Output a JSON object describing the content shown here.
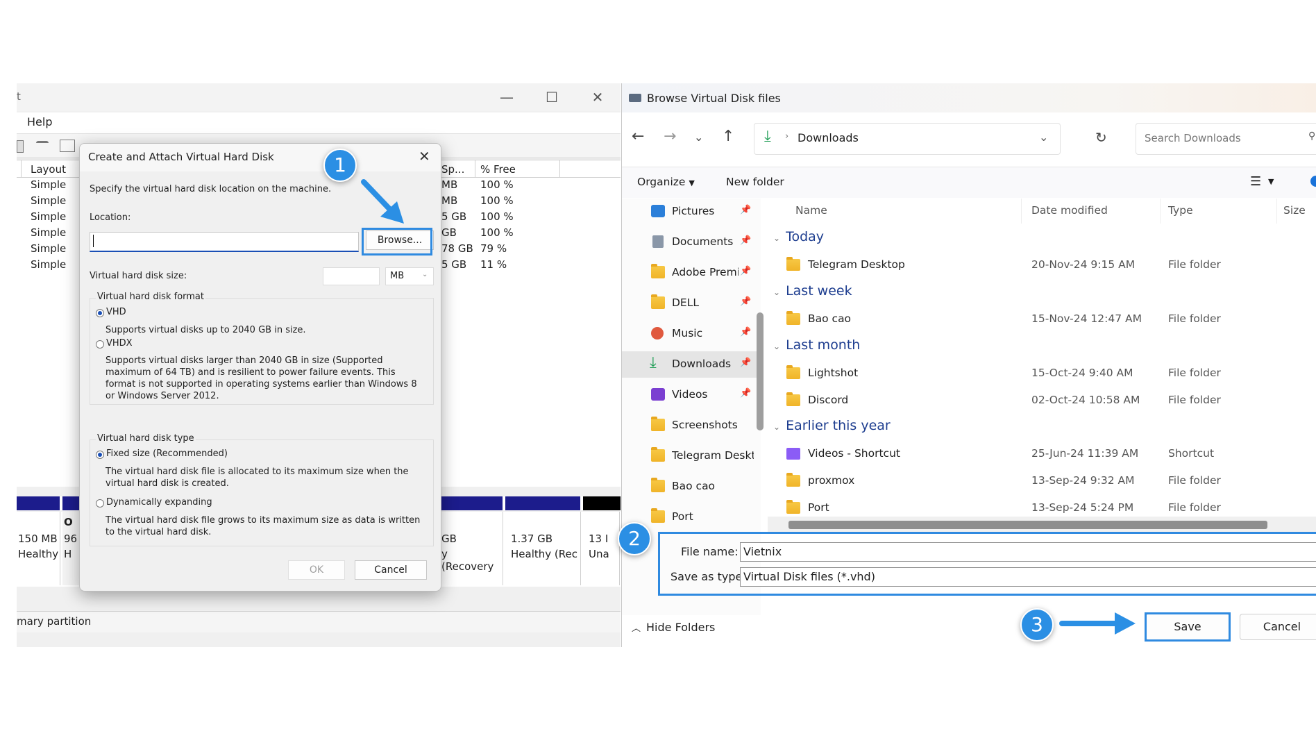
{
  "disk_mgmt": {
    "title_fragment": "t",
    "menu_help": "Help",
    "columns": {
      "layout": "Layout",
      "space": "Sp...",
      "free": "% Free"
    },
    "rows": [
      {
        "layout": "Simple",
        "space": "MB",
        "free": "100 %"
      },
      {
        "layout": "Simple",
        "space": "MB",
        "free": "100 %"
      },
      {
        "layout": "Simple",
        "space": "5 GB",
        "free": "100 %"
      },
      {
        "layout": "Simple",
        "space": "GB",
        "free": "100 %"
      },
      {
        "layout": "Simple",
        "space": "78 GB",
        "free": "79 %"
      },
      {
        "layout": "Simple",
        "space": "5 GB",
        "free": "11 %"
      }
    ],
    "partitions": {
      "p1_size": "150 MB",
      "p1_status": "Healthy",
      "p2_a": "O",
      "p2_b": "96",
      "p2_c": "H",
      "p3_size": "GB",
      "p3_status": "y (Recovery",
      "p4_size": "1.37 GB",
      "p4_status": "Healthy (Rec",
      "p5_size": "13 I",
      "p5_status": "Una"
    },
    "legend": "mary partition"
  },
  "vhd_dialog": {
    "title": "Create and Attach Virtual Hard Disk",
    "close_glyph": "✕",
    "instruction": "Specify the virtual hard disk location on the machine.",
    "location_label": "Location:",
    "location_value": "",
    "browse_label": "Browse...",
    "size_label": "Virtual hard disk size:",
    "size_value": "",
    "size_unit": "MB",
    "format_group": "Virtual hard disk format",
    "vhd_label": "VHD",
    "vhd_desc": "Supports virtual disks up to 2040 GB in size.",
    "vhdx_label": "VHDX",
    "vhdx_desc_1": "Supports virtual disks larger than 2040 GB in size (Supported",
    "vhdx_desc_2": "maximum of 64 TB) and is resilient to power failure events. This",
    "vhdx_desc_3": "format is not supported in operating systems earlier than Windows 8",
    "vhdx_desc_4": "or Windows Server 2012.",
    "type_group": "Virtual hard disk type",
    "fixed_label": "Fixed size (Recommended)",
    "fixed_desc_1": "The virtual hard disk file is allocated to its maximum size when the",
    "fixed_desc_2": "virtual hard disk is created.",
    "dynamic_label": "Dynamically expanding",
    "dynamic_desc_1": "The virtual hard disk file grows to its maximum size as data is written",
    "dynamic_desc_2": "to the virtual hard disk.",
    "ok_label": "OK",
    "cancel_label": "Cancel"
  },
  "explorer": {
    "title": "Browse Virtual Disk files",
    "address": "Downloads",
    "search_placeholder": "Search Downloads",
    "organize": "Organize",
    "new_folder": "New folder",
    "nav_items": [
      {
        "label": "Pictures"
      },
      {
        "label": "Documents"
      },
      {
        "label": "Adobe Premiere"
      },
      {
        "label": "DELL"
      },
      {
        "label": "Music"
      },
      {
        "label": "Downloads"
      },
      {
        "label": "Videos"
      },
      {
        "label": "Screenshots"
      },
      {
        "label": "Telegram Desktop"
      },
      {
        "label": "Bao cao"
      },
      {
        "label": "Port"
      }
    ],
    "columns": {
      "name": "Name",
      "date": "Date modified",
      "type": "Type",
      "size": "Size"
    },
    "groups": {
      "today": "Today",
      "last_week": "Last week",
      "last_month": "Last month",
      "earlier": "Earlier this year"
    },
    "files": [
      {
        "name": "Telegram Desktop",
        "date": "20-Nov-24 9:15 AM",
        "type": "File folder"
      },
      {
        "name": "Bao cao",
        "date": "15-Nov-24 12:47 AM",
        "type": "File folder"
      },
      {
        "name": "Lightshot",
        "date": "15-Oct-24 9:40 AM",
        "type": "File folder"
      },
      {
        "name": "Discord",
        "date": "02-Oct-24 10:58 AM",
        "type": "File folder"
      },
      {
        "name": "Videos - Shortcut",
        "date": "25-Jun-24 11:39 AM",
        "type": "Shortcut"
      },
      {
        "name": "proxmox",
        "date": "13-Sep-24 9:32 AM",
        "type": "File folder"
      },
      {
        "name": "Port",
        "date": "13-Sep-24 5:24 PM",
        "type": "File folder"
      }
    ],
    "file_name_label": "File name:",
    "file_name_value": "Vietnix",
    "save_type_label": "Save as type:",
    "save_type_value": "Virtual Disk files (*.vhd)",
    "hide_folders": "Hide Folders",
    "save_label": "Save",
    "cancel_label": "Cancel"
  },
  "annotations": {
    "step1": "1",
    "step2": "2",
    "step3": "3",
    "accent": "#2b8fe4"
  }
}
